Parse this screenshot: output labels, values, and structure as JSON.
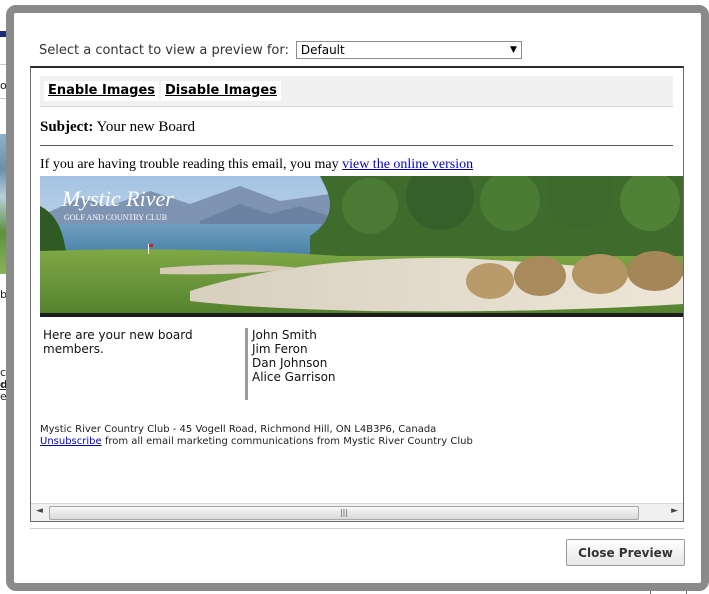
{
  "background_page": {
    "fragments": [
      "on",
      "boa",
      "club",
      "dis",
      "ema"
    ]
  },
  "dialog": {
    "select_label": "Select a contact to view a preview for:",
    "selected_contact": "Default",
    "close_label": "Close Preview"
  },
  "preview": {
    "enable_images": "Enable Images",
    "disable_images": "Disable Images",
    "subject_label": "Subject:",
    "subject": "Your new Board",
    "trouble_text": "If you are having trouble reading this email, you may",
    "online_link": "view the online version",
    "banner_logo_line1": "Mystic River",
    "banner_logo_line2": "GOLF AND COUNTRY CLUB",
    "intro_text": "Here are your new board members.",
    "members": [
      "John Smith",
      "Jim Feron",
      "Dan Johnson",
      "Alice Garrison"
    ],
    "footer_address": "Mystic River Country Club - 45 Vogell Road, Richmond Hill, ON L4B3P6, Canada",
    "unsubscribe_label": "Unsubscribe",
    "unsubscribe_suffix": "from all email marketing communications from Mystic River Country Club"
  },
  "colors": {
    "modal_frame": "#8a8a8a",
    "link": "#0000cc",
    "accent_bar": "#1b2a78"
  }
}
